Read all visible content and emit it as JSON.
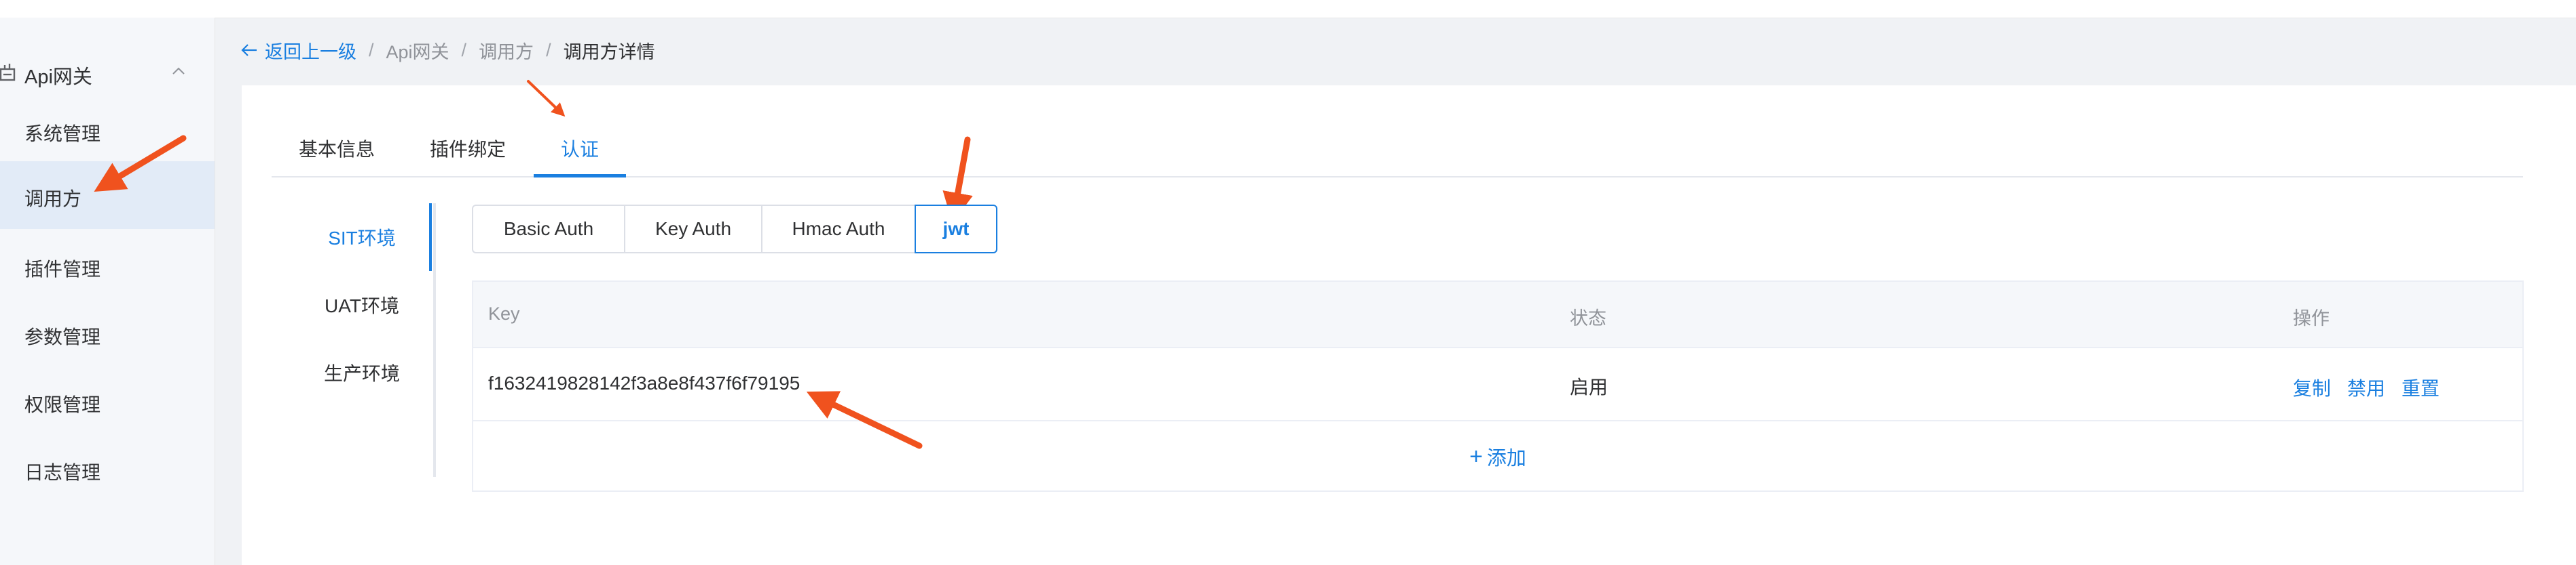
{
  "sidebar": {
    "group_label": "Api网关",
    "items": [
      {
        "label": "系统管理",
        "active": false
      },
      {
        "label": "调用方",
        "active": true
      },
      {
        "label": "插件管理",
        "active": false
      },
      {
        "label": "参数管理",
        "active": false
      },
      {
        "label": "权限管理",
        "active": false
      },
      {
        "label": "日志管理",
        "active": false
      }
    ]
  },
  "breadcrumb": {
    "back_label": "返回上一级",
    "separator": "/",
    "items": [
      "Api网关",
      "调用方"
    ],
    "current": "调用方详情"
  },
  "tabs": [
    {
      "label": "基本信息",
      "active": false
    },
    {
      "label": "插件绑定",
      "active": false
    },
    {
      "label": "认证",
      "active": true
    }
  ],
  "environments": [
    {
      "label": "SIT环境",
      "active": true
    },
    {
      "label": "UAT环境",
      "active": false
    },
    {
      "label": "生产环境",
      "active": false
    }
  ],
  "auth_types": [
    {
      "label": "Basic Auth",
      "active": false
    },
    {
      "label": "Key Auth",
      "active": false
    },
    {
      "label": "Hmac Auth",
      "active": false
    },
    {
      "label": "jwt",
      "active": true
    }
  ],
  "table": {
    "columns": [
      "Key",
      "状态",
      "操作"
    ],
    "rows": [
      {
        "key": "f1632419828142f3a8e8f437f6f79195",
        "status": "启用",
        "actions": [
          "复制",
          "禁用",
          "重置"
        ]
      }
    ],
    "add_label": "添加"
  },
  "colors": {
    "accent": "#1a7fe0",
    "annotation_arrow": "#f0521e",
    "sidebar_active_bg": "#e2ebf7"
  },
  "icons": {
    "group": "gateway-icon",
    "group_toggle": "chevron-up-icon",
    "back": "arrow-left-icon",
    "add": "plus-icon"
  }
}
